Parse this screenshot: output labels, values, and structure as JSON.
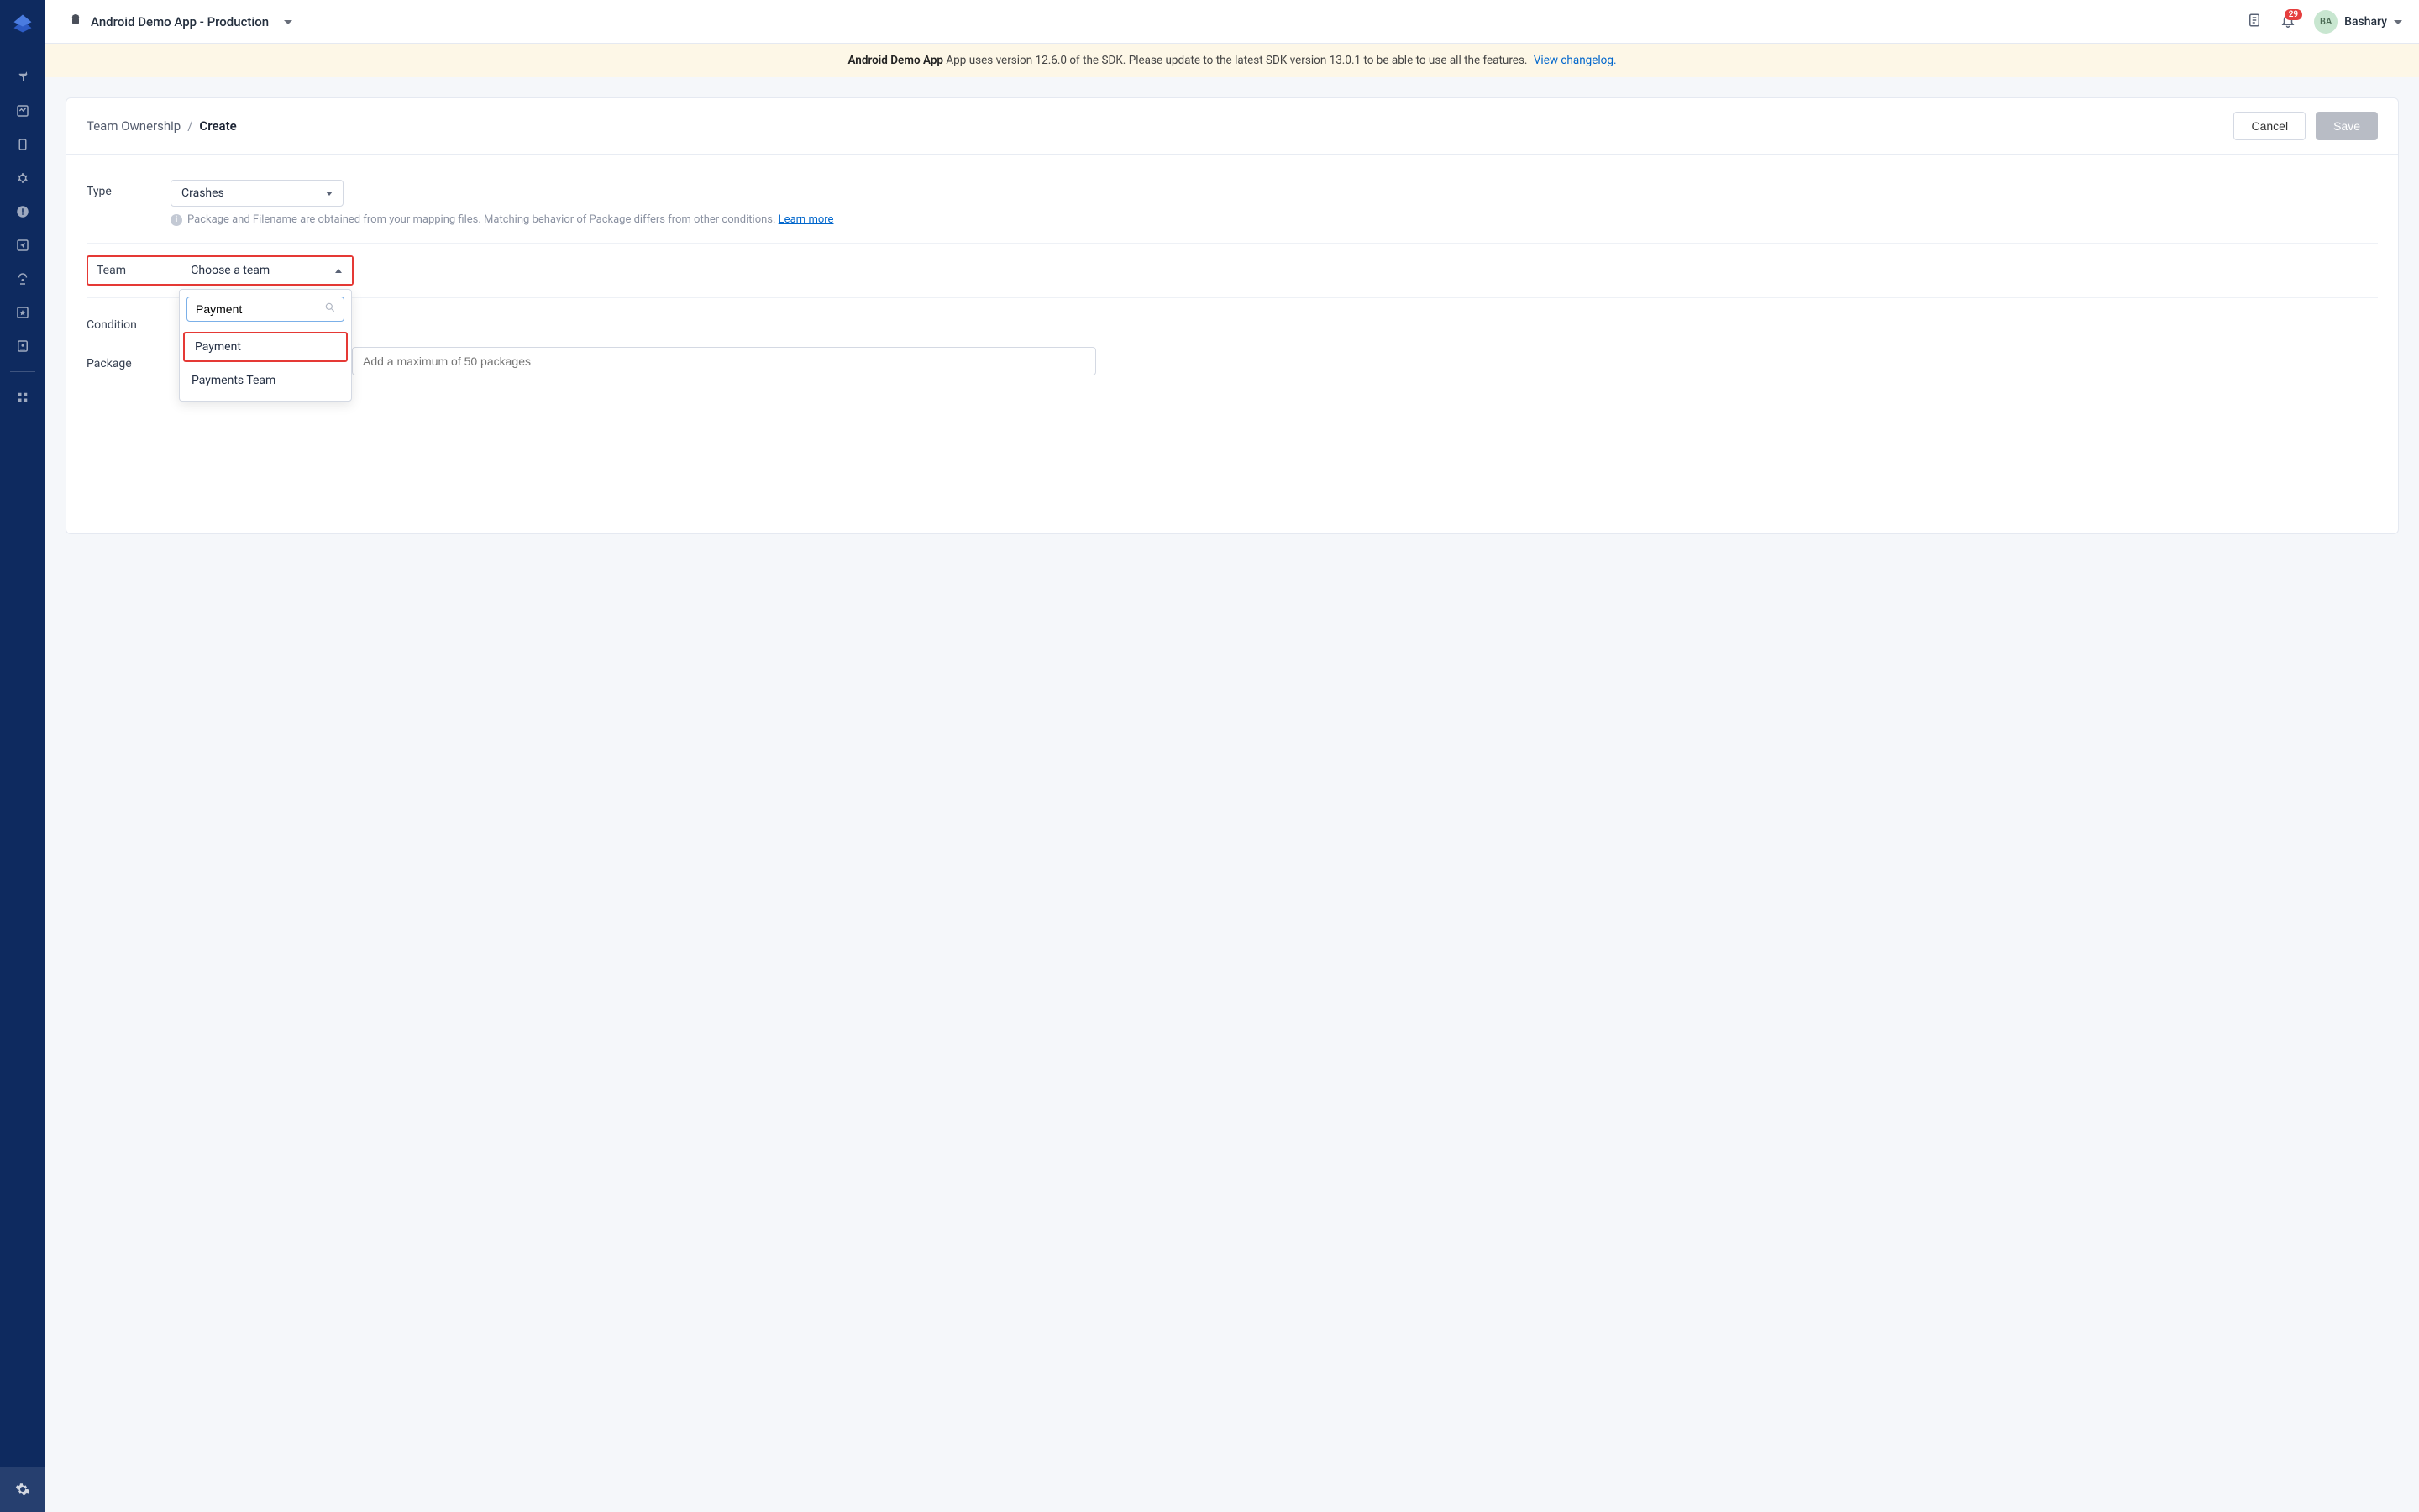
{
  "header": {
    "app_name": "Android Demo App - Production",
    "user_initials": "BA",
    "user_name": "Bashary",
    "notification_count": "29"
  },
  "banner": {
    "bold": "Android Demo App",
    "text": " App uses version 12.6.0 of the SDK. Please update to the latest SDK version 13.0.1 to be able to use all the features. ",
    "link": "View changelog."
  },
  "breadcrumb": {
    "parent": "Team Ownership",
    "sep": "/",
    "current": "Create"
  },
  "actions": {
    "cancel": "Cancel",
    "save": "Save"
  },
  "form": {
    "type_label": "Type",
    "type_value": "Crashes",
    "help_text": "Package and Filename are obtained from your mapping files. Matching behavior of Package differs from other conditions. ",
    "help_link": "Learn more",
    "team_label": "Team",
    "team_placeholder": "Choose a team",
    "condition_label": "Condition",
    "package_label": "Package",
    "package_placeholder": "Add a maximum of 50 packages"
  },
  "dropdown": {
    "search_value": "Payment",
    "options": [
      "Payment",
      "Payments Team"
    ]
  }
}
